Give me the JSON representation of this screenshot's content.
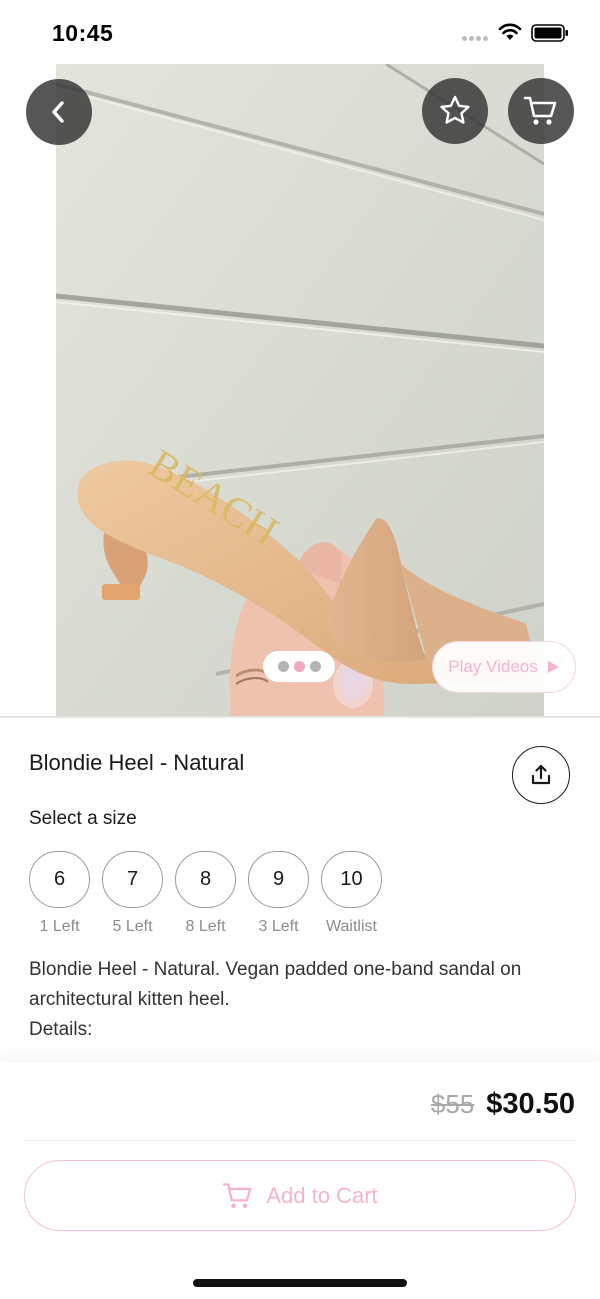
{
  "status_bar": {
    "time": "10:45"
  },
  "hero": {
    "play_videos_label": "Play Videos",
    "carousel_pages": 3,
    "active_page": 2
  },
  "product": {
    "title": "Blondie Heel - Natural",
    "size_heading": "Select a size",
    "sizes": [
      {
        "size": "6",
        "stock": "1 Left"
      },
      {
        "size": "7",
        "stock": "5 Left"
      },
      {
        "size": "8",
        "stock": "8 Left"
      },
      {
        "size": "9",
        "stock": "3 Left"
      },
      {
        "size": "10",
        "stock": "Waitlist"
      }
    ],
    "description": "Blondie Heel - Natural. Vegan padded one-band sandal on architectural kitten heel.",
    "details_label": "Details:"
  },
  "purchase": {
    "old_price": "$55",
    "price": "$30.50",
    "add_to_cart_label": "Add to Cart"
  },
  "icons": {
    "back": "chevron-left-icon",
    "favorite": "star-icon",
    "cart": "cart-icon",
    "share": "share-icon",
    "play": "play-icon"
  },
  "colors": {
    "accent_pink": "#f4b4cb",
    "overlay_button": "#3a3a3a"
  }
}
